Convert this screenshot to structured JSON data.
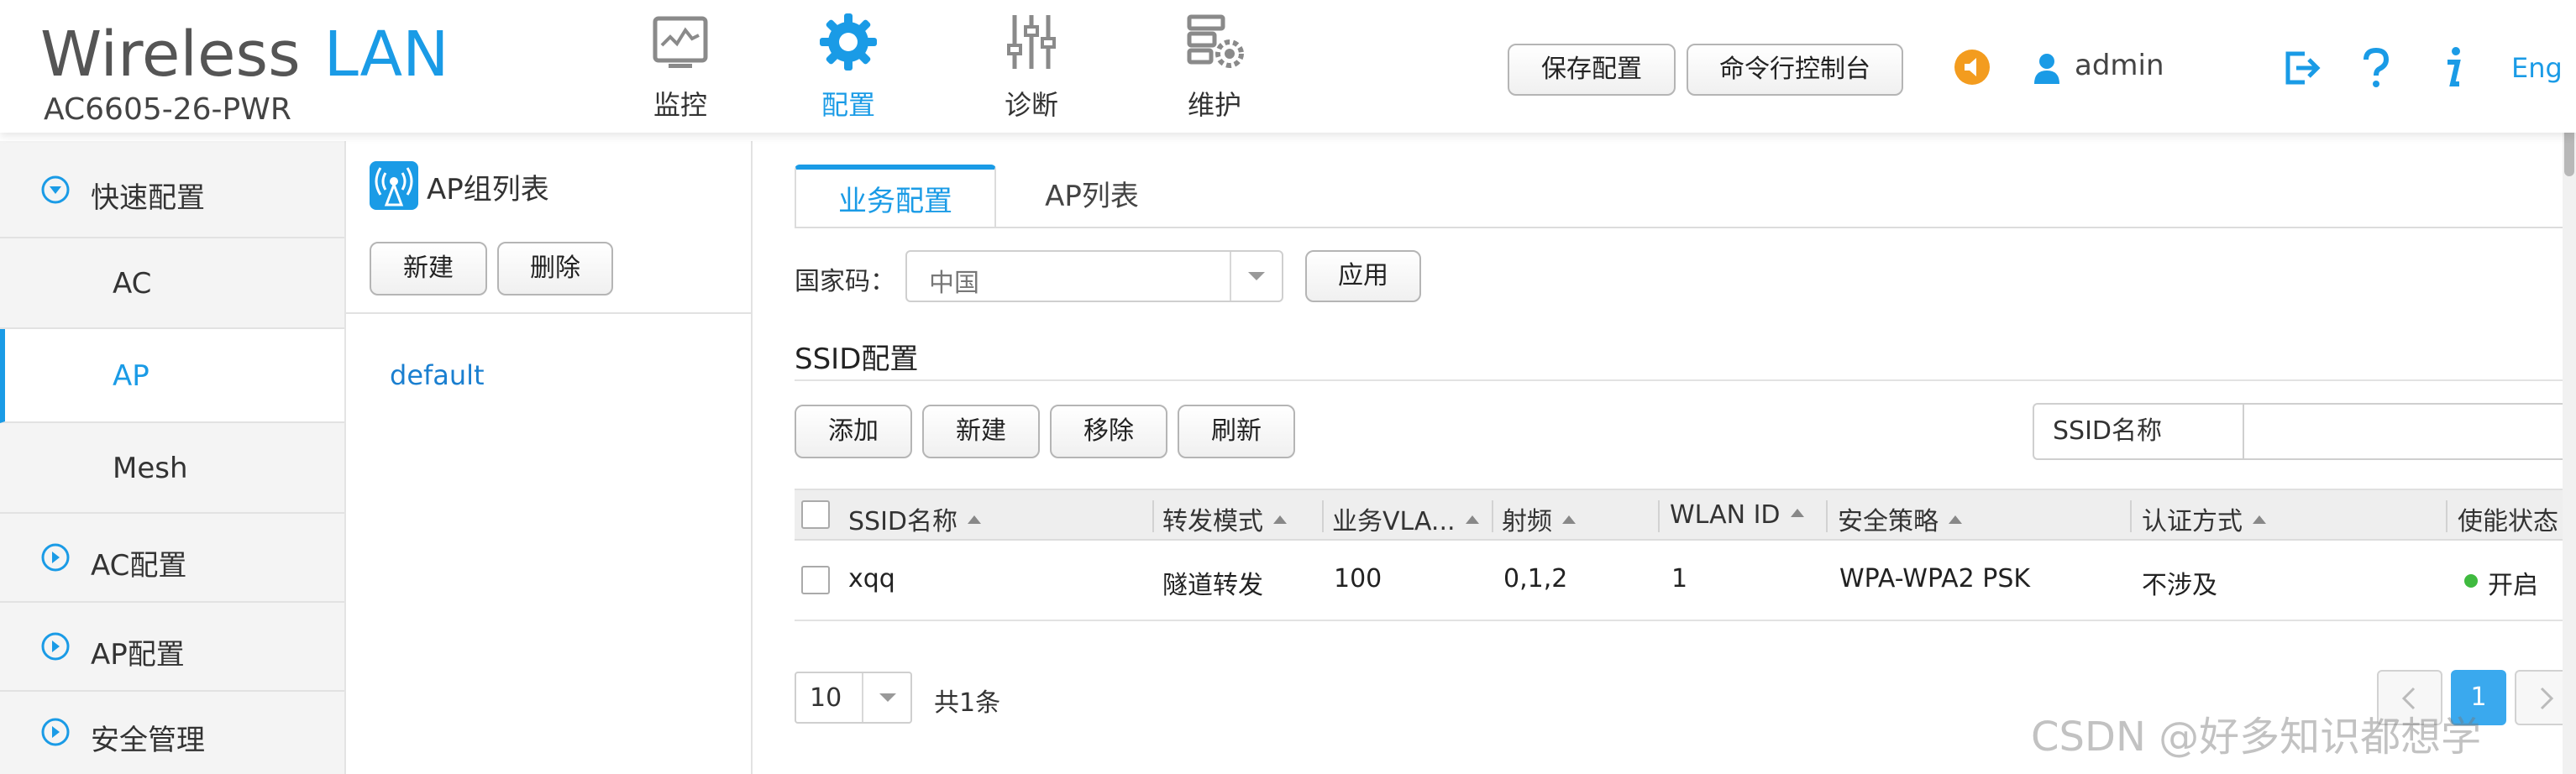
{
  "brand": {
    "title_part1": "Wireless",
    "title_part2": "LAN",
    "model": "AC6605-26-PWR"
  },
  "colors": {
    "accent": "#1a9be6",
    "status_on": "#3fba3f",
    "alert": "#f39c1f"
  },
  "nav": [
    {
      "label": "监控",
      "icon": "monitor-icon"
    },
    {
      "label": "配置",
      "icon": "gear-icon",
      "active": true
    },
    {
      "label": "诊断",
      "icon": "sliders-icon"
    },
    {
      "label": "维护",
      "icon": "server-gear-icon"
    }
  ],
  "header_buttons": {
    "save": "保存配置",
    "console": "命令行控制台"
  },
  "user": {
    "name": "admin"
  },
  "header_links": {
    "lang": "Eng"
  },
  "sidebar": {
    "items": [
      {
        "label": "快速配置",
        "icon": "circle-chevron-down-icon"
      },
      {
        "label": "AC"
      },
      {
        "label": "AP",
        "active": true
      },
      {
        "label": "Mesh"
      },
      {
        "label": "AC配置",
        "icon": "circle-chevron-right-icon"
      },
      {
        "label": "AP配置",
        "icon": "circle-chevron-right-icon"
      },
      {
        "label": "安全管理",
        "icon": "circle-chevron-right-icon"
      }
    ]
  },
  "group_panel": {
    "title": "AP组列表",
    "new_button": "新建",
    "delete_button": "删除",
    "groups": [
      "default"
    ]
  },
  "tabs": {
    "business": "业务配置",
    "ap_list": "AP列表"
  },
  "country": {
    "label": "国家码：",
    "value": "中国",
    "apply_button": "应用"
  },
  "ssid": {
    "section_title": "SSID配置",
    "buttons": {
      "add": "添加",
      "new": "新建",
      "remove": "移除",
      "refresh": "刷新"
    },
    "search_label": "SSID名称",
    "search_value": "",
    "columns": [
      "SSID名称",
      "转发模式",
      "业务VLA...",
      "射频",
      "WLAN ID",
      "安全策略",
      "认证方式",
      "使能状态"
    ],
    "rows": [
      {
        "ssid": "xqq",
        "forward_mode": "隧道转发",
        "vlan": "100",
        "radio": "0,1,2",
        "wlan_id": "1",
        "security": "WPA-WPA2 PSK",
        "auth": "不涉及",
        "status": "开启"
      }
    ]
  },
  "pagination": {
    "page_size": "10",
    "total": "共1条",
    "current_page": "1"
  },
  "watermark": "CSDN @好多知识都想学"
}
